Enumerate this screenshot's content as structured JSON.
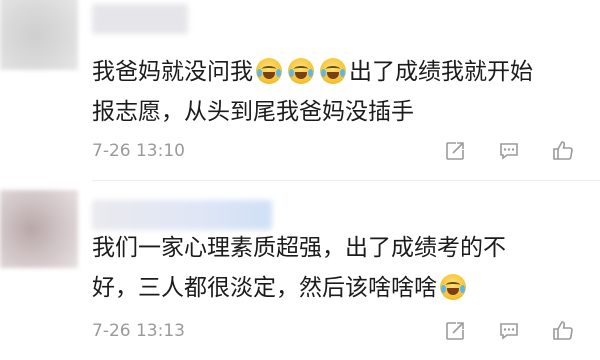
{
  "comments": [
    {
      "lines": [
        "我爸妈就没问我",
        "出了成绩我就开始",
        "报志愿，从头到尾我爸妈没插手"
      ],
      "emoji_count": 3,
      "time": "7-26 13:10",
      "icons": [
        "share-icon",
        "comment-icon",
        "like-icon"
      ]
    },
    {
      "lines": [
        "我们一家心理素质超强，出了成绩考的不",
        "好，三人都很淡定，然后该啥啥啥"
      ],
      "emoji_count": 1,
      "time": "7-26 13:13",
      "icons": [
        "share-icon",
        "comment-icon",
        "like-icon"
      ]
    }
  ],
  "colors": {
    "text": "#1b1b1b",
    "meta": "#9a9a9a",
    "icon": "#9b9b9b",
    "divider": "#ececec"
  }
}
